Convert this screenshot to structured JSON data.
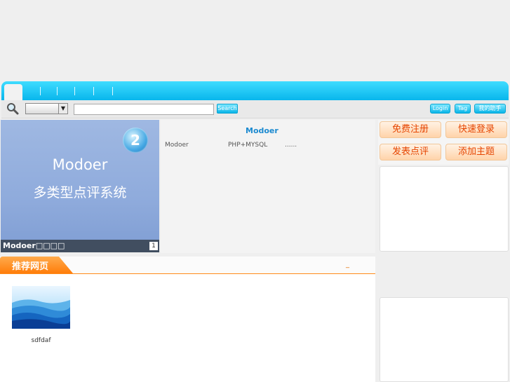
{
  "nav": {
    "home_label": "",
    "items": [
      "",
      "",
      "",
      "",
      ""
    ]
  },
  "search": {
    "category_value": "",
    "placeholder": "",
    "button_label": "Search"
  },
  "user_links": {
    "login": "Login",
    "tag": "Tag",
    "helper": "我的助手"
  },
  "banner": {
    "badge": "2",
    "title": "Modoer",
    "subtitle": "多类型点评系统",
    "caption": "Modoer□□□□",
    "page": "1"
  },
  "intro": {
    "title": "Modoer",
    "words": [
      "Modoer",
      "PHP+MYSQL",
      "......"
    ]
  },
  "actions": {
    "register": "免费注册",
    "quick_login": "快速登录",
    "post_review": "发表点评",
    "add_topic": "添加主题"
  },
  "section": {
    "title": "推荐网页",
    "more": "_",
    "items": [
      {
        "label": "sdfdaf"
      }
    ]
  },
  "colors": {
    "nav": "#08b6ec",
    "accent_orange": "#ff8a19",
    "link_blue": "#1b8ad0"
  }
}
